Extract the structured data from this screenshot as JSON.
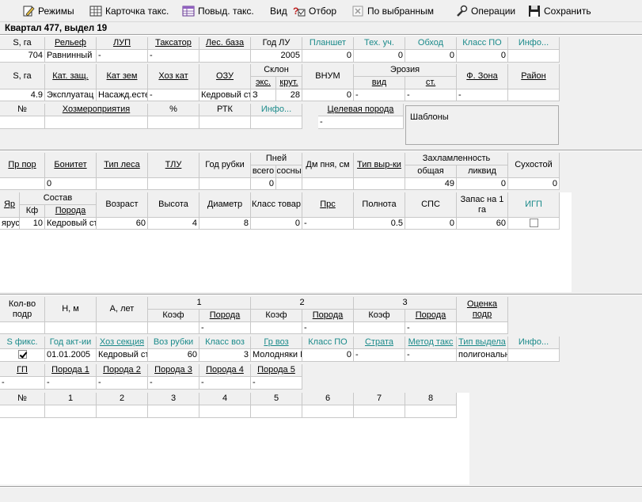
{
  "toolbar": {
    "modes": "Режимы",
    "card": "Карточка такс.",
    "card2": "Повыд. такс.",
    "view": "Вид",
    "filter": "Отбор",
    "selected": "По выбранным",
    "operations": "Операции",
    "save": "Сохранить"
  },
  "title": "Квартал 477, выдел 19",
  "t1": {
    "h": [
      "S, га",
      "Рельеф",
      "ЛУП",
      "Таксатор",
      "Лес. база",
      "Год ЛУ",
      "Планшет",
      "Тех. уч.",
      "Обход",
      "Класс ПО",
      "Инфо..."
    ],
    "v": [
      "704",
      "Равнинный",
      "-",
      "-",
      "",
      "2005",
      "0",
      "0",
      "0",
      "0",
      ""
    ]
  },
  "t2": {
    "h": [
      "S, га",
      "Кат. защ.",
      "Кат зем",
      "Хоз кат",
      "ОЗУ",
      "Склон",
      "экс.",
      "крут.",
      "ВНУМ",
      "Эрозия",
      "вид",
      "ст.",
      "Ф. Зона",
      "Район"
    ],
    "v": [
      "4.9",
      "Эксплуатац",
      "Насажд.есте",
      "-",
      "Кедровый ст",
      "З",
      "28",
      "0",
      "-",
      "-",
      "-",
      ""
    ]
  },
  "t3": {
    "h": [
      "№",
      "Хозмероприятия",
      "%",
      "РТК",
      "Инфо..."
    ],
    "target": "Целевая порода",
    "target_val": "-",
    "templates": "Шаблоны"
  },
  "t4": {
    "h": [
      "Пр пор",
      "Бонитет",
      "Тип леса",
      "ТЛУ",
      "Год рубки",
      "Пней",
      "всего",
      "сосны",
      "Дм пня, см",
      "Тип выр-ки",
      "Захламленность",
      "общая",
      "ликвид",
      "Сухостой"
    ],
    "v": [
      "",
      "0",
      "",
      "",
      "",
      "0",
      "",
      "",
      "",
      "",
      "49",
      "0",
      "0"
    ]
  },
  "t5": {
    "h": [
      "Яр",
      "Состав",
      "Кф",
      "Порода",
      "Возраст",
      "Высота",
      "Диаметр",
      "Класс товар",
      "Прс",
      "Полнота",
      "СПС",
      "Запас на 1 га",
      "ИГП"
    ],
    "v": [
      "ярус",
      "10",
      "Кедровый ст",
      "60",
      "4",
      "8",
      "0",
      "-",
      "0.5",
      "0",
      "60"
    ]
  },
  "t6": {
    "h": [
      "Кол-во подр",
      "Н, м",
      "А, лет",
      "1",
      "2",
      "3",
      "Коэф",
      "Порода",
      "Коэф",
      "Порода",
      "Коэф",
      "Порода",
      "Оценка подр"
    ],
    "v": [
      "-",
      "-",
      "-"
    ]
  },
  "t7": {
    "h": [
      "S фикс.",
      "Год акт-ии",
      "Хоз секция",
      "Воз рубки",
      "Класс воз",
      "Гр воз",
      "Класс ПО",
      "Страта",
      "Метод такс",
      "Тип выдела",
      "Инфо..."
    ],
    "v": [
      "01.01.2005",
      "Кедровый ст",
      "60",
      "3",
      "Молодняки I",
      "0",
      "-",
      "-",
      "полигональн"
    ]
  },
  "t8": {
    "h": [
      "ГП",
      "Порода 1",
      "Порода 2",
      "Порода 3",
      "Порода 4",
      "Порода 5"
    ],
    "v": [
      "-",
      "-",
      "-",
      "-",
      "-",
      "-"
    ]
  },
  "t9": {
    "h": [
      "№",
      "1",
      "2",
      "3",
      "4",
      "5",
      "6",
      "7",
      "8"
    ]
  }
}
